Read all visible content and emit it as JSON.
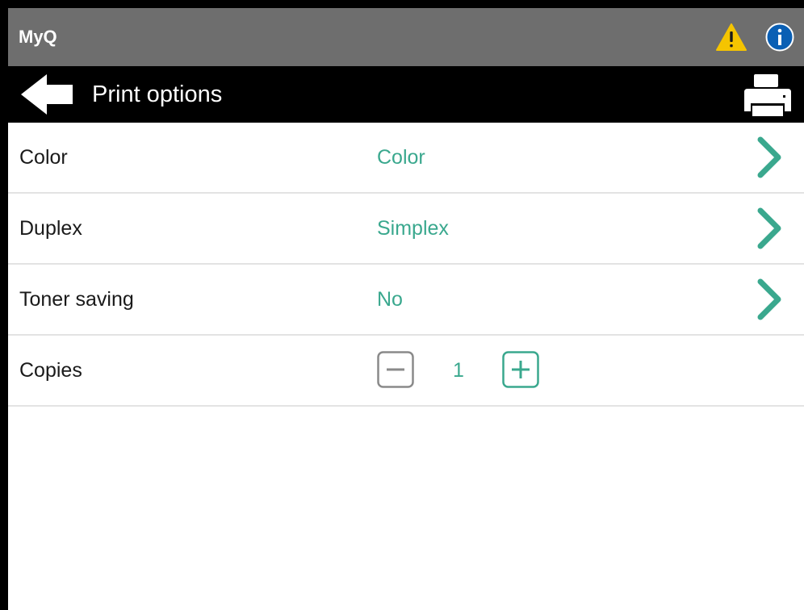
{
  "status_bar": {
    "app_name": "MyQ",
    "icons": [
      "warning-icon",
      "info-icon"
    ]
  },
  "header": {
    "title": "Print options",
    "icons": [
      "back-arrow-icon",
      "printer-icon"
    ]
  },
  "options": [
    {
      "label": "Color",
      "value": "Color"
    },
    {
      "label": "Duplex",
      "value": "Simplex"
    },
    {
      "label": "Toner saving",
      "value": "No"
    }
  ],
  "copies": {
    "label": "Copies",
    "value": "1"
  },
  "colors": {
    "accent": "#3aa88e",
    "status_bar": "#6e6e6e",
    "header_bar": "#000000",
    "warning": "#f5c400",
    "info": "#0a5fb4"
  }
}
